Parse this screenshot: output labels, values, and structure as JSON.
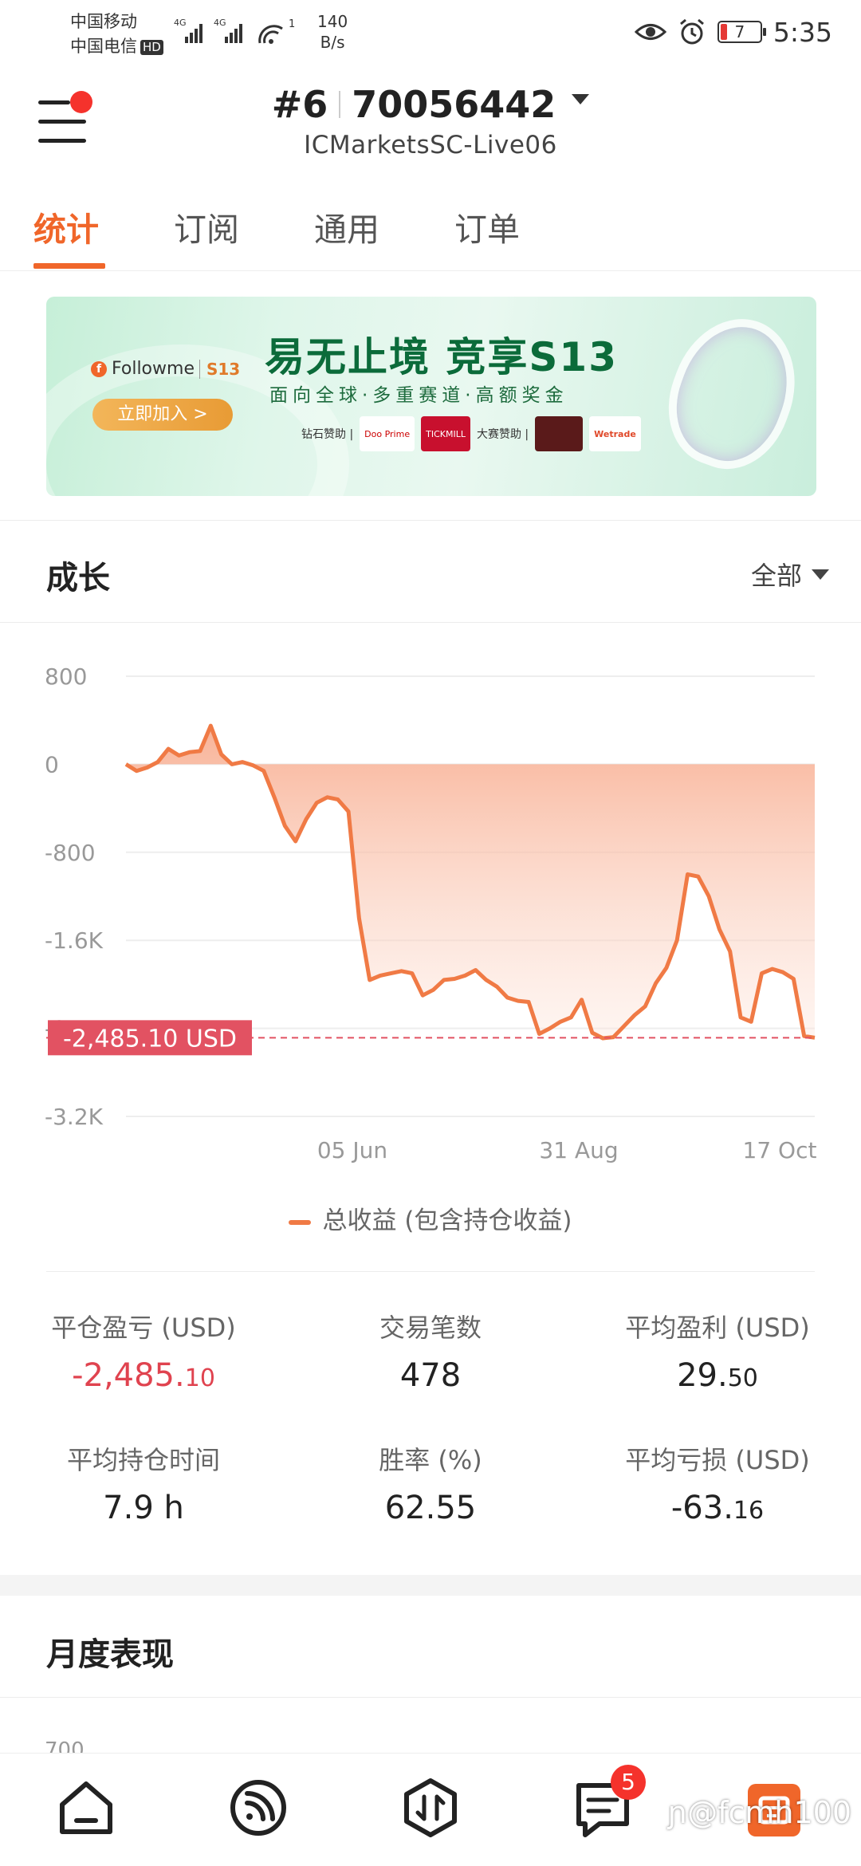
{
  "status_bar": {
    "carrier1": "中国移动",
    "carrier2": "中国电信",
    "hd": "HD",
    "net1": "4G",
    "net2": "4G",
    "hotspot_count": "1",
    "speed_value": "140",
    "speed_unit": "B/s",
    "battery": "7",
    "time": "5:35"
  },
  "header": {
    "rank": "#6",
    "account_number": "70056442",
    "server": "ICMarketsSC-Live06"
  },
  "tabs": [
    {
      "label": "统计",
      "active": true
    },
    {
      "label": "订阅",
      "active": false
    },
    {
      "label": "通用",
      "active": false
    },
    {
      "label": "订单",
      "active": false
    }
  ],
  "banner": {
    "brand": "Followme",
    "season_badge": "S13",
    "headline": "易无止境 竞享S13",
    "subline": "面向全球·多重赛道·高额奖金",
    "join_button": "立即加入 >",
    "sponsor_label_1": "钻石赞助 |",
    "sponsor_label_2": "大赛赞助 |",
    "sponsor_1": "Doo Prime",
    "sponsor_2": "TICKMILL",
    "sponsor_3": "Wetrade"
  },
  "growth": {
    "title": "成长",
    "filter": "全部"
  },
  "chart_data": {
    "type": "area",
    "title": "",
    "xlabel": "",
    "ylabel": "",
    "ylim": [
      -3200,
      800
    ],
    "y_ticks": [
      "800",
      "0",
      "-800",
      "-1.6K",
      "-2.4K",
      "-3.2K"
    ],
    "x_ticks": [
      "05 Jun",
      "31 Aug",
      "17 Oct"
    ],
    "current_value_label": "-2,485.10 USD",
    "current_value": -2485.1,
    "grid": true,
    "series": [
      {
        "name": "总收益 (包含持仓收益)",
        "color": "#f07a45",
        "values": [
          0,
          -60,
          -30,
          20,
          140,
          80,
          110,
          120,
          350,
          90,
          0,
          20,
          -10,
          -60,
          -300,
          -560,
          -700,
          -500,
          -350,
          -300,
          -320,
          -430,
          -1400,
          -1960,
          -1920,
          -1900,
          -1880,
          -1900,
          -2100,
          -2050,
          -1960,
          -1950,
          -1920,
          -1870,
          -1960,
          -2020,
          -2120,
          -2150,
          -2160,
          -2450,
          -2400,
          -2340,
          -2300,
          -2140,
          -2440,
          -2490,
          -2480,
          -2380,
          -2280,
          -2200,
          -1990,
          -1850,
          -1600,
          -1000,
          -1020,
          -1200,
          -1500,
          -1700,
          -2300,
          -2340,
          -1900,
          -1860,
          -1890,
          -1950,
          -2470,
          -2485
        ]
      }
    ]
  },
  "stats": [
    {
      "label": "平仓盈亏 (USD)",
      "value_main": "-2,485.",
      "value_small": "10",
      "negative": true
    },
    {
      "label": "交易笔数",
      "value_main": "478",
      "value_small": "",
      "negative": false
    },
    {
      "label": "平均盈利 (USD)",
      "value_main": "29.",
      "value_small": "50",
      "negative": false
    },
    {
      "label": "平均持仓时间",
      "value_main": "7.9 h",
      "value_small": "",
      "negative": false
    },
    {
      "label": "胜率 (%)",
      "value_main": "62.55",
      "value_small": "",
      "negative": false
    },
    {
      "label": "平均亏损 (USD)",
      "value_main": "-63.",
      "value_small": "16",
      "negative": false
    }
  ],
  "monthly": {
    "title": "月度表现",
    "first_tick": "700"
  },
  "bottom_nav": {
    "items": [
      "home-icon",
      "feed-icon",
      "trade-icon",
      "messages-icon",
      "me-icon"
    ],
    "messages_badge": "5",
    "watermark": "ɲ@fcmh100"
  },
  "colors": {
    "accent": "#f0662a",
    "line": "#f07a45",
    "negative": "#e0434f",
    "value_label_bg": "#e25262"
  }
}
